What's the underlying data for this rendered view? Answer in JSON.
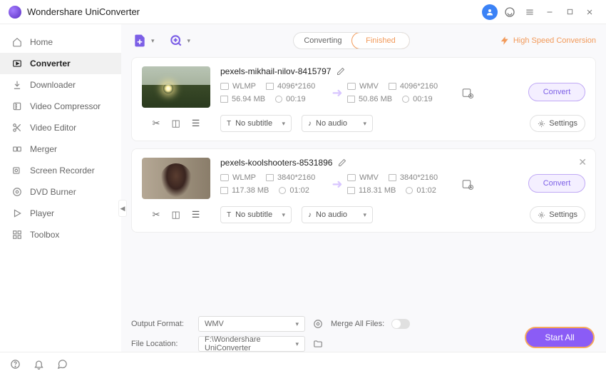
{
  "app": {
    "title": "Wondershare UniConverter"
  },
  "sidebar": {
    "items": [
      {
        "label": "Home"
      },
      {
        "label": "Converter"
      },
      {
        "label": "Downloader"
      },
      {
        "label": "Video Compressor"
      },
      {
        "label": "Video Editor"
      },
      {
        "label": "Merger"
      },
      {
        "label": "Screen Recorder"
      },
      {
        "label": "DVD Burner"
      },
      {
        "label": "Player"
      },
      {
        "label": "Toolbox"
      }
    ]
  },
  "tabs": {
    "converting": "Converting",
    "finished": "Finished"
  },
  "high_speed": "High Speed Conversion",
  "files": [
    {
      "name": "pexels-mikhail-nilov-8415797",
      "in_format": "WLMP",
      "in_res": "4096*2160",
      "in_size": "56.94 MB",
      "in_dur": "00:19",
      "out_format": "WMV",
      "out_res": "4096*2160",
      "out_size": "50.86 MB",
      "out_dur": "00:19",
      "subtitle": "No subtitle",
      "audio": "No audio",
      "convert": "Convert",
      "settings": "Settings"
    },
    {
      "name": "pexels-koolshooters-8531896",
      "in_format": "WLMP",
      "in_res": "3840*2160",
      "in_size": "117.38 MB",
      "in_dur": "01:02",
      "out_format": "WMV",
      "out_res": "3840*2160",
      "out_size": "118.31 MB",
      "out_dur": "01:02",
      "subtitle": "No subtitle",
      "audio": "No audio",
      "convert": "Convert",
      "settings": "Settings"
    }
  ],
  "bottom": {
    "output_format_label": "Output Format:",
    "output_format": "WMV",
    "file_location_label": "File Location:",
    "file_location": "F:\\Wondershare UniConverter",
    "merge_label": "Merge All Files:",
    "start_all": "Start All"
  }
}
